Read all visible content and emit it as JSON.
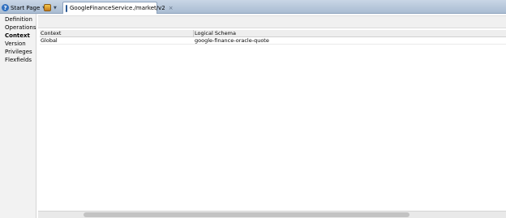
{
  "tabs": {
    "start_page": "Start Page",
    "active_tab": "GoogleFinanceService./market/v2",
    "close_glyph": "×",
    "caret_glyph": "▼"
  },
  "nav": {
    "items": [
      {
        "label": "Definition",
        "active": false
      },
      {
        "label": "Operations",
        "active": false
      },
      {
        "label": "Context",
        "active": true
      },
      {
        "label": "Version",
        "active": false
      },
      {
        "label": "Privileges",
        "active": false
      },
      {
        "label": "Flexfields",
        "active": false
      }
    ]
  },
  "table": {
    "headers": [
      "Context",
      "Logical Schema"
    ],
    "rows": [
      [
        "Global",
        "google-finance-oracle-quote"
      ]
    ]
  },
  "scrollbar": {
    "thumb_start": 0.097,
    "thumb_extent": 0.697
  },
  "colors": {
    "tabstrip": "#b6c6da",
    "nav_bg": "#f2f2f2",
    "header_bg": "#eeeeee"
  }
}
